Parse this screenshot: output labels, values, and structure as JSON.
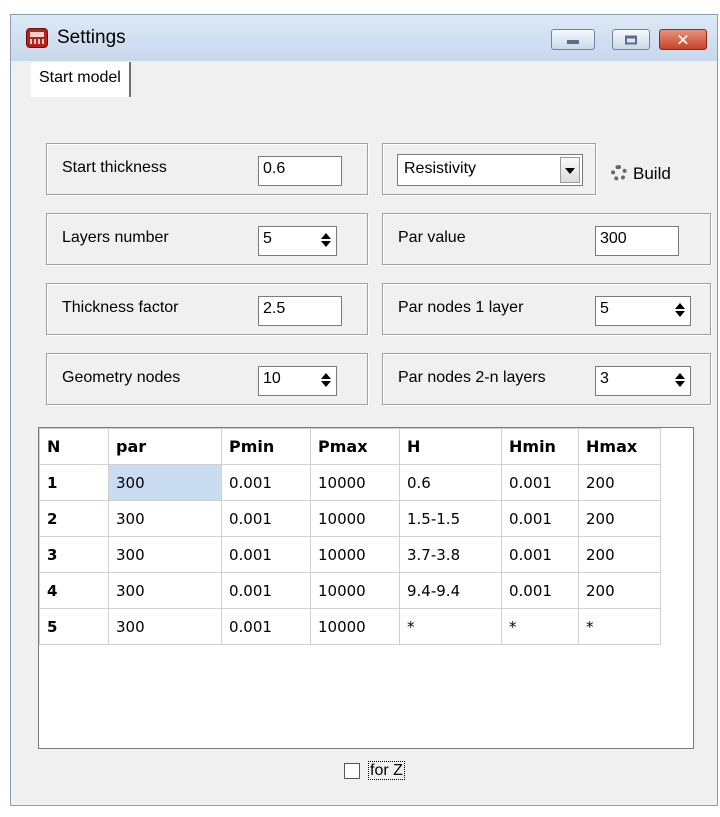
{
  "window": {
    "title": "Settings"
  },
  "tabs": [
    {
      "label": "Start model"
    }
  ],
  "left_fields": [
    {
      "label": "Start thickness",
      "value": "0.6",
      "spinner": false
    },
    {
      "label": "Layers number",
      "value": "5",
      "spinner": true
    },
    {
      "label": "Thickness factor",
      "value": "2.5",
      "spinner": false
    },
    {
      "label": "Geometry nodes",
      "value": "10",
      "spinner": true
    }
  ],
  "param_select": {
    "selected": "Resistivity"
  },
  "build_button": {
    "label": "Build",
    "icon": "gear-icon"
  },
  "right_fields": [
    {
      "label": "Par value",
      "value": "300",
      "spinner": false
    },
    {
      "label": "Par nodes 1 layer",
      "value": "5",
      "spinner": true
    },
    {
      "label": "Par nodes 2-n layers",
      "value": "3",
      "spinner": true
    }
  ],
  "table": {
    "columns": [
      "N",
      "par",
      "Pmin",
      "Pmax",
      "H",
      "Hmin",
      "Hmax"
    ],
    "rows": [
      [
        "1",
        "300",
        "0.001",
        "10000",
        "0.6",
        "0.001",
        "200"
      ],
      [
        "2",
        "300",
        "0.001",
        "10000",
        "1.5-1.5",
        "0.001",
        "200"
      ],
      [
        "3",
        "300",
        "0.001",
        "10000",
        "3.7-3.8",
        "0.001",
        "200"
      ],
      [
        "4",
        "300",
        "0.001",
        "10000",
        "9.4-9.4",
        "0.001",
        "200"
      ],
      [
        "5",
        "300",
        "0.001",
        "10000",
        "*",
        "*",
        "*"
      ]
    ],
    "selected_cell": {
      "row": 0,
      "col": 1
    }
  },
  "checkbox": {
    "label": "for Z",
    "checked": false
  }
}
